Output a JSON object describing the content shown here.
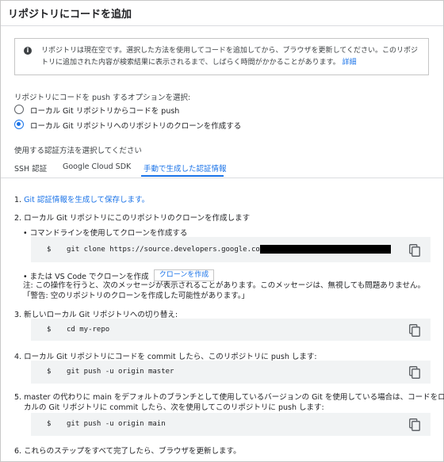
{
  "title": "リポジトリにコードを追加",
  "notice": {
    "text": "リポジトリは現在空です。選択した方法を使用してコードを追加してから、ブラウザを更新してください。このリポジトリに追加された内容が検索結果に表示されるまで、しばらく時間がかかることがあります。",
    "link": "詳細"
  },
  "push_options": {
    "label": "リポジトリにコードを push するオプションを選択:",
    "options": [
      {
        "label": "ローカル Git リポジトリからコードを push",
        "checked": false
      },
      {
        "label": "ローカル Git リポジトリへのリポジトリのクローンを作成する",
        "checked": true
      }
    ]
  },
  "auth": {
    "label": "使用する認証方法を選択してください",
    "tabs": [
      "SSH 認証",
      "Google Cloud SDK",
      "手動で生成した認証情報"
    ],
    "active_tab": 2
  },
  "steps": {
    "s1_prefix": "1. ",
    "s1_link": "Git 認証情報を生成して保存します。",
    "s2": "2. ローカル Git リポジトリにこのリポジトリのクローンを作成します",
    "s2_cli": "コマンドラインを使用してクローンを作成する",
    "s2_clone_cmd": "git clone https://source.developers.google.com/p/",
    "s2_vscode": "または VS Code でクローンを作成",
    "s2_vscode_button": "クローンを作成",
    "s2_note1": "注: この操作を行うと、次のメッセージが表示されることがあります。このメッセージは、無視しても問題ありません。",
    "s2_note2": "「警告: 空のリポジトリのクローンを作成した可能性があります。」",
    "s3": "3. 新しいローカル Git リポジトリへの切り替え:",
    "s3_cmd": "cd my-repo",
    "s4": "4. ローカル Git リポジトリにコードを commit したら、このリポジトリに push します:",
    "s4_cmd": "git push -u origin master",
    "s5_line1": "5. master の代わりに main をデフォルトのブランチとして使用しているバージョンの Git を使用している場合は、コードをロー",
    "s5_line2": "カルの Git リポジトリに commit したら、次を使用してこのリポジトリに push します:",
    "s5_cmd": "git push -u origin main",
    "s6": "6. これらのステップをすべて完了したら、ブラウザを更新します。"
  },
  "prompt": "$",
  "bullet": "•",
  "icons": {
    "info": "info-icon",
    "copy": "copy-icon"
  },
  "colors": {
    "accent": "#1a73e8",
    "code_bg": "#f1f3f4"
  }
}
